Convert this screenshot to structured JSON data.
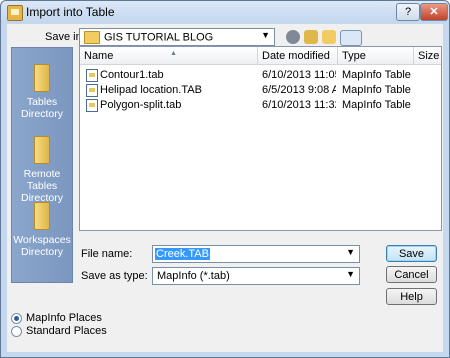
{
  "window": {
    "title": "Import into Table",
    "help": "?",
    "close": "✕"
  },
  "toolbar": {
    "save_in_label": "Save in:",
    "location": "GIS TUTORIAL BLOG"
  },
  "columns": [
    "Name",
    "Date modified",
    "Type",
    "Size"
  ],
  "files": [
    {
      "name": "Contour1.tab",
      "date": "6/10/2013 11:05...",
      "type": "MapInfo Table",
      "size": ""
    },
    {
      "name": "Helipad location.TAB",
      "date": "6/5/2013 9:08 A...",
      "type": "MapInfo Table",
      "size": ""
    },
    {
      "name": "Polygon-split.tab",
      "date": "6/10/2013 11:32...",
      "type": "MapInfo Table",
      "size": ""
    }
  ],
  "places": [
    {
      "label": "Tables Directory"
    },
    {
      "label": "Remote Tables Directory"
    },
    {
      "label": "Workspaces Directory"
    }
  ],
  "form": {
    "file_name_label": "File name:",
    "file_name_value": "Creek.TAB",
    "save_as_type_label": "Save as type:",
    "save_as_type_value": "MapInfo (*.tab)"
  },
  "buttons": {
    "save": "Save",
    "cancel": "Cancel",
    "help": "Help"
  },
  "radios": {
    "mapinfo_places": "MapInfo Places",
    "standard_places": "Standard Places"
  }
}
